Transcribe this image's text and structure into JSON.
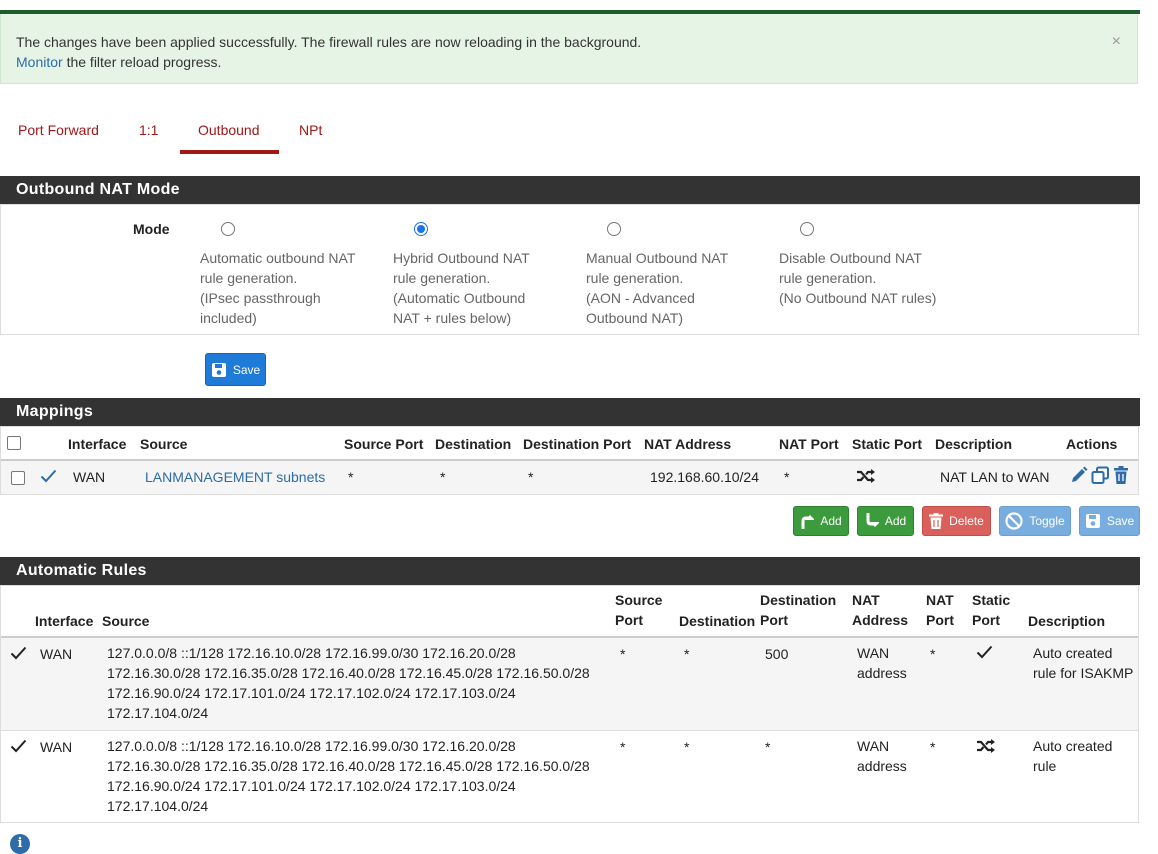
{
  "alert": {
    "message": "The changes have been applied successfully. The firewall rules are now reloading in the background.",
    "link_text": "Monitor",
    "message_suffix": " the filter reload progress.",
    "close_glyph": "×"
  },
  "tabs": [
    {
      "label": "Port Forward"
    },
    {
      "label": "1:1"
    },
    {
      "label": "Outbound",
      "active": true
    },
    {
      "label": "NPt"
    }
  ],
  "nat_mode": {
    "title": "Outbound NAT Mode",
    "mode_label": "Mode",
    "options": [
      {
        "lines": [
          "Automatic outbound NAT",
          "rule generation.",
          "(IPsec passthrough",
          "included)"
        ],
        "checked": false
      },
      {
        "lines": [
          "Hybrid Outbound NAT",
          "rule generation.",
          "(Automatic Outbound",
          "NAT + rules below)"
        ],
        "checked": true
      },
      {
        "lines": [
          "Manual Outbound NAT",
          "rule generation.",
          "(AON - Advanced",
          "Outbound NAT)"
        ],
        "checked": false
      },
      {
        "lines": [
          "Disable Outbound NAT",
          "rule generation.",
          "(No Outbound NAT rules)"
        ],
        "checked": false
      }
    ],
    "save_label": "Save"
  },
  "mappings": {
    "title": "Mappings",
    "headers": [
      "Interface",
      "Source",
      "Source Port",
      "Destination",
      "Destination Port",
      "NAT Address",
      "NAT Port",
      "Static Port",
      "Description",
      "Actions"
    ],
    "rows": [
      {
        "interface": "WAN",
        "source": "LANMANAGEMENT subnets",
        "source_port": "*",
        "destination": "*",
        "destination_port": "*",
        "nat_address": "192.168.60.10/24",
        "nat_port": "*",
        "static_port_icon": "shuffle-icon",
        "description": "NAT LAN to WAN"
      }
    ],
    "buttons": {
      "add_top": "Add",
      "add_bottom": "Add",
      "delete": "Delete",
      "toggle": "Toggle",
      "save": "Save"
    }
  },
  "auto_rules": {
    "title": "Automatic Rules",
    "headers": {
      "interface": "Interface",
      "source": "Source",
      "source_port_1": "Source",
      "source_port_2": "Port",
      "destination": "Destination",
      "destination_port_1": "Destination",
      "destination_port_2": "Port",
      "nat_address_1": "NAT",
      "nat_address_2": "Address",
      "nat_port_1": "NAT",
      "nat_port_2": "Port",
      "static_port_1": "Static",
      "static_port_2": "Port",
      "description": "Description"
    },
    "rows": [
      {
        "interface": "WAN",
        "source_lines": [
          "127.0.0.0/8 ::1/128 172.16.10.0/28 172.16.99.0/30 172.16.20.0/28",
          "172.16.30.0/28 172.16.35.0/28 172.16.40.0/28 172.16.45.0/28 172.16.50.0/28",
          "172.16.90.0/24 172.17.101.0/24 172.17.102.0/24 172.17.103.0/24",
          "172.17.104.0/24"
        ],
        "source_port": "*",
        "destination": "*",
        "destination_port": "500",
        "nat_address_lines": [
          "WAN",
          "address"
        ],
        "nat_port": "*",
        "static_port_icon": "check-icon",
        "description_lines": [
          "Auto created",
          "rule for ISAKMP"
        ]
      },
      {
        "interface": "WAN",
        "source_lines": [
          "127.0.0.0/8 ::1/128 172.16.10.0/28 172.16.99.0/30 172.16.20.0/28",
          "172.16.30.0/28 172.16.35.0/28 172.16.40.0/28 172.16.45.0/28 172.16.50.0/28",
          "172.16.90.0/24 172.17.101.0/24 172.17.102.0/24 172.17.103.0/24",
          "172.17.104.0/24"
        ],
        "source_port": "*",
        "destination": "*",
        "destination_port": "*",
        "nat_address_lines": [
          "WAN",
          "address"
        ],
        "nat_port": "*",
        "static_port_icon": "shuffle-icon",
        "description_lines": [
          "Auto created",
          "rule"
        ]
      }
    ]
  },
  "info_glyph": "i",
  "colors": {
    "accent": "#a01818",
    "link": "#2d6ca8",
    "panel_header": "#333333",
    "success_bg": "#e6f4e6"
  }
}
